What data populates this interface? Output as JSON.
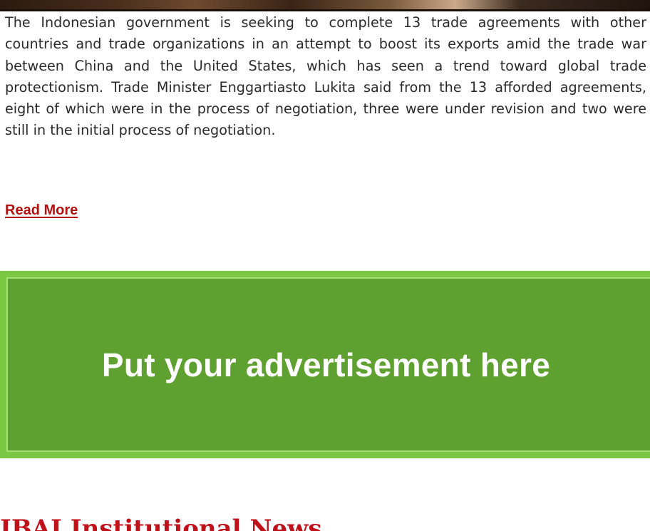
{
  "article": {
    "body": "The Indonesian government is seeking to complete 13 trade agreements with other countries and trade organizations in an attempt to boost its ex­ports amid the trade war between China and the United States, which has seen a trend toward global trade protectionism. Trade Minister Enggartiasto Lukita said from the 13 afforded agreements, eight of which were in the pro­cess of negotiation, three were under revision and two were still in the initial process of negotiation.",
    "read_more_label": "Read More"
  },
  "advertisement": {
    "text": "Put your advertisement here"
  },
  "section": {
    "title": "IBAI Institutional News"
  },
  "colors": {
    "link": "#b30f0f",
    "ad_background": "#5fa130",
    "ad_border": "#7bc642",
    "section_title": "#c0101a"
  }
}
